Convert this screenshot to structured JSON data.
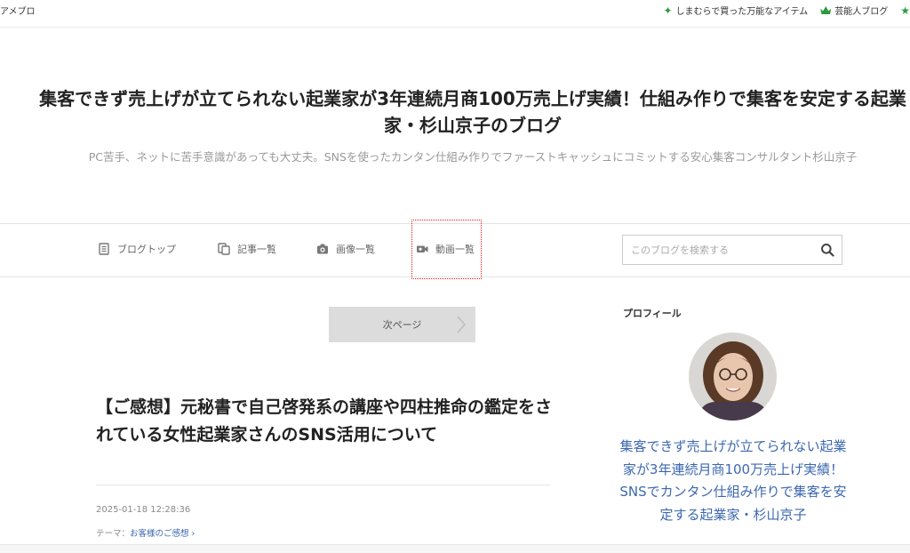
{
  "topbar": {
    "brand": "アメブロ",
    "links": [
      {
        "label": "しまむらで買った万能なアイテム",
        "icon": "sparkle-icon"
      },
      {
        "label": "芸能人ブログ",
        "icon": "crown-icon"
      },
      {
        "label": "",
        "icon": "star-icon"
      }
    ]
  },
  "header": {
    "title": "集客できず売上げが立てられない起業家が3年連続月商100万売上げ実績！仕組み作りで集客を安定する起業家・杉山京子のブログ",
    "description": "PC苦手、ネットに苦手意識があっても大丈夫。SNSを使ったカンタン仕組み作りでファーストキャッシュにコミットする安心集客コンサルタント杉山京子"
  },
  "nav": {
    "items": [
      {
        "label": "ブログトップ",
        "icon": "document-icon"
      },
      {
        "label": "記事一覧",
        "icon": "copy-icon"
      },
      {
        "label": "画像一覧",
        "icon": "camera-icon"
      },
      {
        "label": "動画一覧",
        "icon": "video-camera-icon"
      }
    ],
    "search_placeholder": "このブログを検索する"
  },
  "pager": {
    "next_label": "次ページ"
  },
  "article": {
    "title": "【ご感想】元秘書で自己啓発系の講座や四柱推命の鑑定をされている女性起業家さんのSNS活用について",
    "date": "2025-01-18 12:28:36",
    "theme_prefix": "テーマ：",
    "theme": "お客様のご感想 ›"
  },
  "sidebar": {
    "profile_heading": "プロフィール",
    "profile_name": "集客できず売上げが立てられない起業家が3年連続月商100万売上げ実績！SNSでカンタン仕組み作りで集客を安定する起業家・杉山京子"
  },
  "colors": {
    "accent_green": "#2e9b3e",
    "link_blue": "#3c68b0",
    "focus_red": "#e31b1b"
  }
}
